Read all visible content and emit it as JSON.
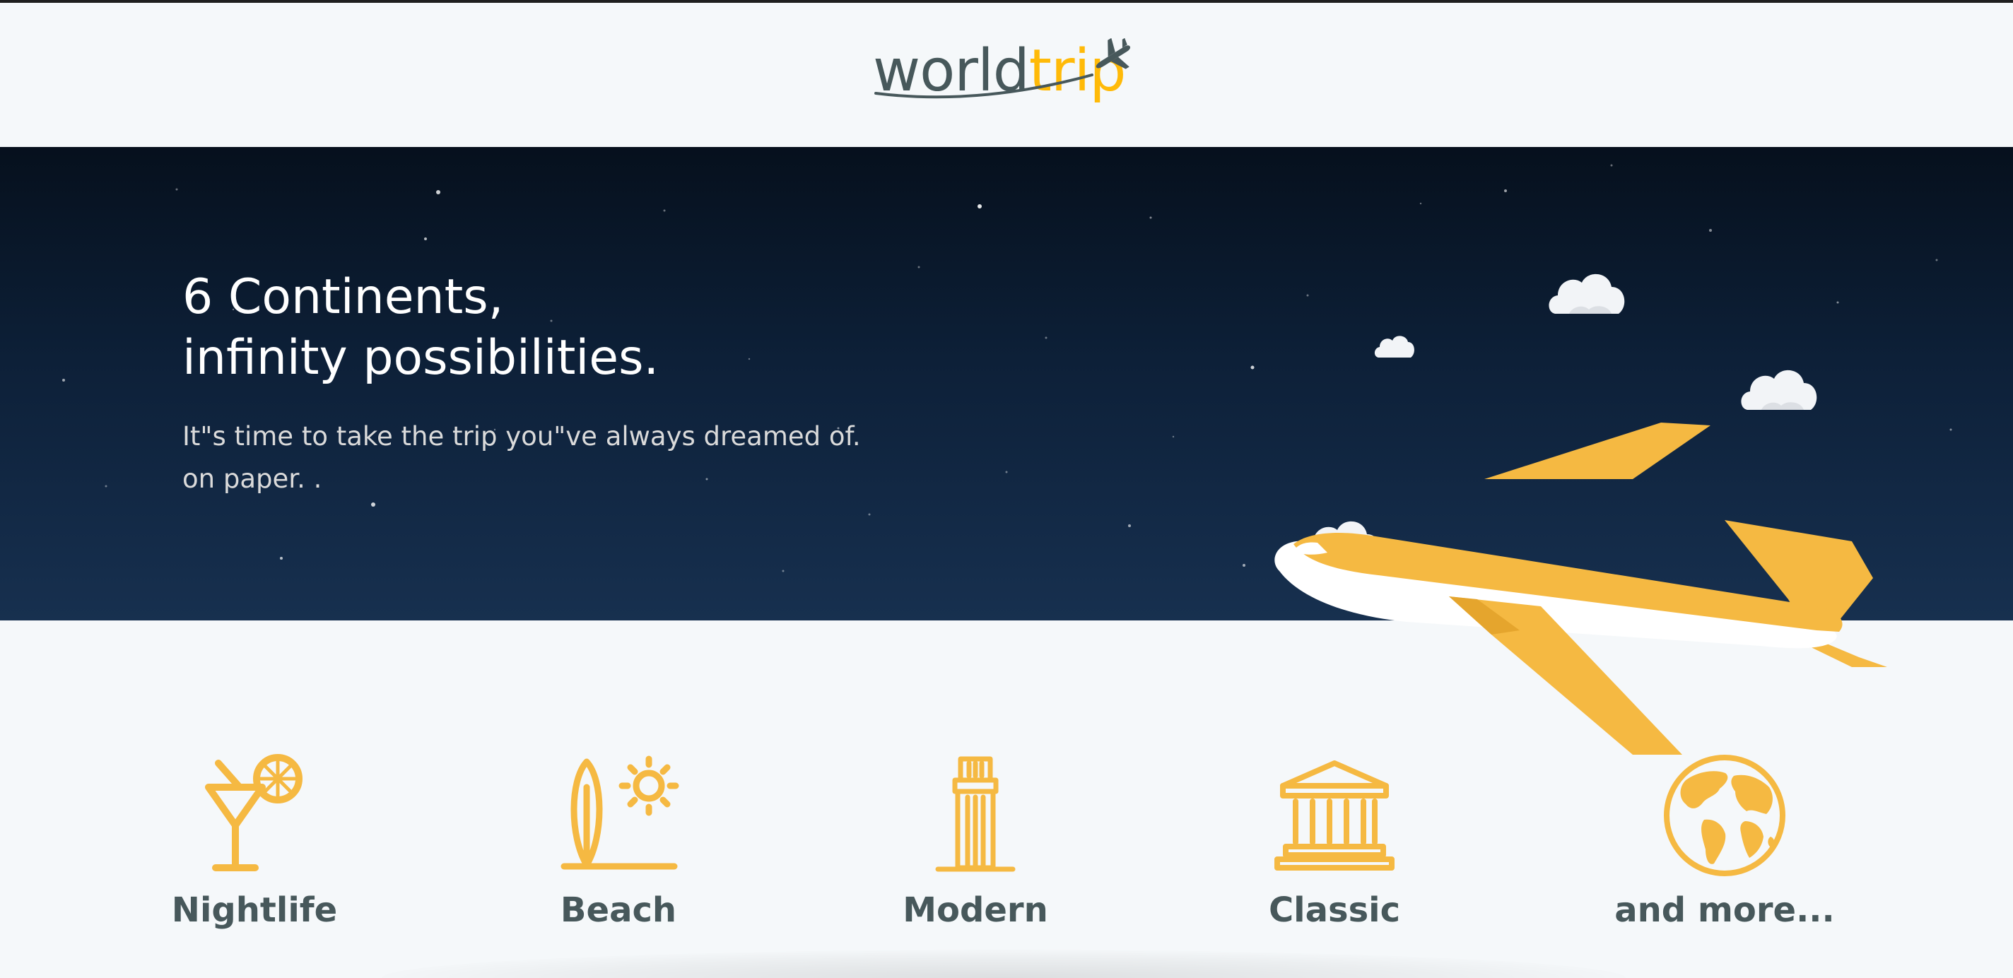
{
  "header": {
    "logo": {
      "part1": "world",
      "part2": "trip",
      "icon": "airplane-icon"
    }
  },
  "banner": {
    "title_line1": "6 Continents,",
    "title_line2": "infinity possibilities.",
    "subtitle_line1": "It\"s time to take the trip you\"ve always dreamed of.",
    "subtitle_line2": "on paper. ."
  },
  "travel_types": [
    {
      "label": "Nightlife",
      "icon": "cocktail-icon"
    },
    {
      "label": "Beach",
      "icon": "surfboard-sun-icon"
    },
    {
      "label": "Modern",
      "icon": "skyscraper-icon"
    },
    {
      "label": "Classic",
      "icon": "classical-building-icon"
    },
    {
      "label": "and more...",
      "icon": "globe-icon"
    }
  ],
  "colors": {
    "accent": "#ffba08",
    "dark_text": "#47585b",
    "banner_dark": "#06101d",
    "banner_light": "#17304f",
    "background": "#f5f8fa"
  }
}
